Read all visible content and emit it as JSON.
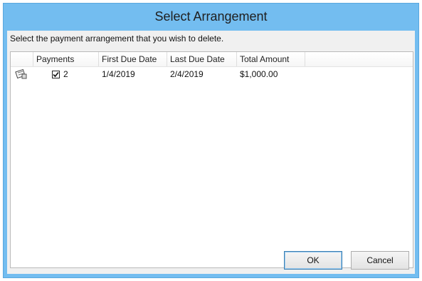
{
  "dialog": {
    "title": "Select Arrangement",
    "prompt": "Select the payment arrangement that you wish to delete."
  },
  "table": {
    "columns": [
      "",
      "Payments",
      "First Due Date",
      "Last Due Date",
      "Total Amount"
    ],
    "rows": [
      {
        "icon": "payment-arrangement-icon",
        "payments_checked": true,
        "payments": "2",
        "first_due_date": "1/4/2019",
        "last_due_date": "2/4/2019",
        "total_amount": "$1,000.00"
      }
    ]
  },
  "buttons": {
    "ok_label": "OK",
    "cancel_label": "Cancel"
  },
  "colors": {
    "titlebar": "#73bdf0",
    "client_bg": "#f0f0f0",
    "list_bg": "#ffffff"
  }
}
